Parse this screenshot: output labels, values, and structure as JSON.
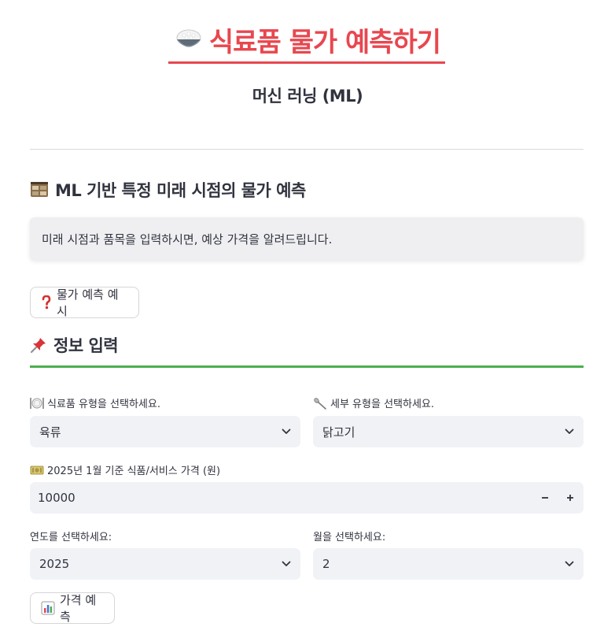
{
  "header": {
    "title": "식료품 물가 예측하기",
    "subtitle": "머신 러닝 (ML)",
    "title_color": "#e8474f"
  },
  "predict_section": {
    "heading": "ML 기반 특정 미래 시점의 물가 예측",
    "heading_icon": "film-frames-icon",
    "info": "미래 시점과 품목을 입력하시면, 예상 가격을 알려드립니다.",
    "example_button": "물가 예측 예시",
    "example_icon": "question-mark-icon"
  },
  "input_section": {
    "heading": "정보 입력",
    "heading_icon": "pushpin-icon",
    "accent_color": "#4caf50"
  },
  "form": {
    "food_type_label": "식료품 유형을 선택하세요.",
    "food_type_icon": "plate-utensils-icon",
    "food_type_value": "육류",
    "sub_type_label": "세부 유형을 선택하세요.",
    "sub_type_icon": "spoon-icon",
    "sub_type_value": "닭고기",
    "price_label": "2025년 1월 기준 식품/서비스 가격 (원)",
    "price_icon": "banknote-icon",
    "price_value": "10000",
    "year_label": "연도를 선택하세요:",
    "year_value": "2025",
    "month_label": "월을 선택하세요:",
    "month_value": "2",
    "predict_button": "가격 예측",
    "predict_icon": "bar-chart-icon"
  }
}
